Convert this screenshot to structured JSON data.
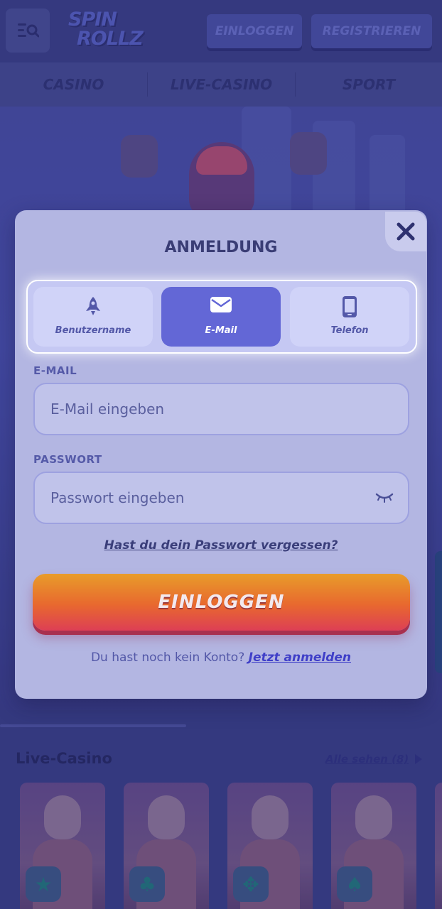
{
  "header": {
    "logo_line1": "SPIN",
    "logo_line2": "ROLLZ",
    "login_label": "EINLOGGEN",
    "register_label": "REGISTRIEREN"
  },
  "nav": {
    "items": [
      {
        "label": "CASINO"
      },
      {
        "label": "LIVE-CASINO"
      },
      {
        "label": "SPORT"
      }
    ]
  },
  "live_section": {
    "title": "Live-Casino",
    "see_all": "Alle sehen (8)",
    "cards": [
      {
        "suit": "★"
      },
      {
        "suit": "♣"
      },
      {
        "suit": "✥"
      },
      {
        "suit": "♠"
      }
    ]
  },
  "modal": {
    "title": "ANMELDUNG",
    "tabs": {
      "username": "Benutzername",
      "email": "E-Mail",
      "phone": "Telefon"
    },
    "email_label": "E-MAIL",
    "email_placeholder": "E-Mail eingeben",
    "password_label": "PASSWORT",
    "password_placeholder": "Passwort eingeben",
    "forgot": "Hast du dein Passwort vergessen?",
    "login_button": "EINLOGGEN",
    "no_account": "Du hast noch kein Konto?",
    "register_link": "Jetzt anmelden"
  },
  "colors": {
    "accent": "#6367d6",
    "login_gradient_top": "#e89c2a",
    "login_gradient_bottom": "#dd3f55"
  },
  "icons": {
    "menu": "menu-search-icon",
    "close": "close-icon",
    "username_tab": "rocket-icon",
    "email_tab": "envelope-icon",
    "phone_tab": "phone-icon",
    "password_toggle": "eye-closed-icon"
  }
}
